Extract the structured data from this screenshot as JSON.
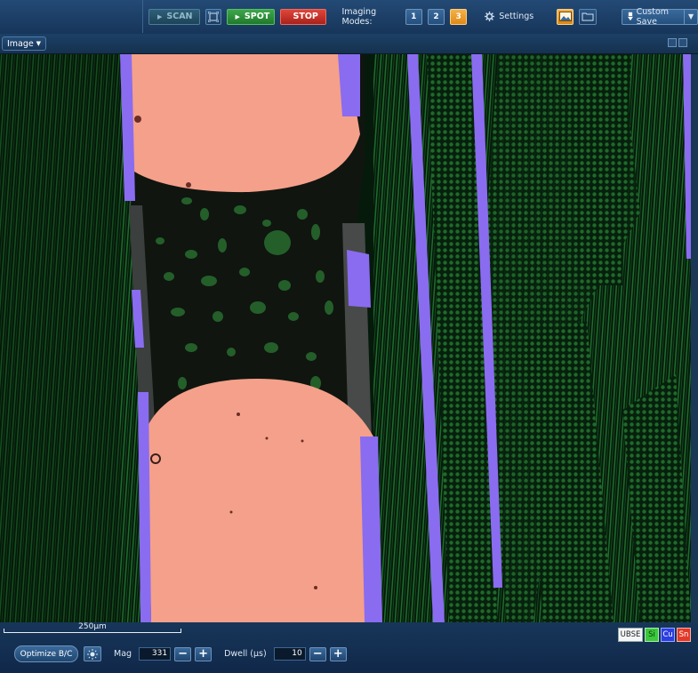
{
  "toolbar": {
    "scan_label": "SCAN",
    "spot_label": "SPOT",
    "stop_label": "STOP",
    "imaging_modes_label": "Imaging Modes:",
    "modes": [
      "1",
      "2",
      "3"
    ],
    "active_mode": "3",
    "settings_label": "Settings",
    "custom_save_label": "Custom Save"
  },
  "image_panel": {
    "view_label": "Image"
  },
  "scalebar": {
    "label": "250µm"
  },
  "bottom": {
    "optimize_label": "Optimize B/C",
    "mag_label": "Mag",
    "mag_value": "331",
    "dwell_label": "Dwell (µs)",
    "dwell_value": "10"
  },
  "channels": [
    {
      "label": "UBSE",
      "color": "#f4f6f8"
    },
    {
      "label": "Si",
      "color": "#3cc83c"
    },
    {
      "label": "Cu",
      "color": "#2b3fe0"
    },
    {
      "label": "Sn",
      "color": "#e23a2a"
    }
  ],
  "colors": {
    "copper": "#f5a08a",
    "purple": "#8a6cf0",
    "green": "#1f7a2e",
    "accent_orange": "#e08a16"
  }
}
